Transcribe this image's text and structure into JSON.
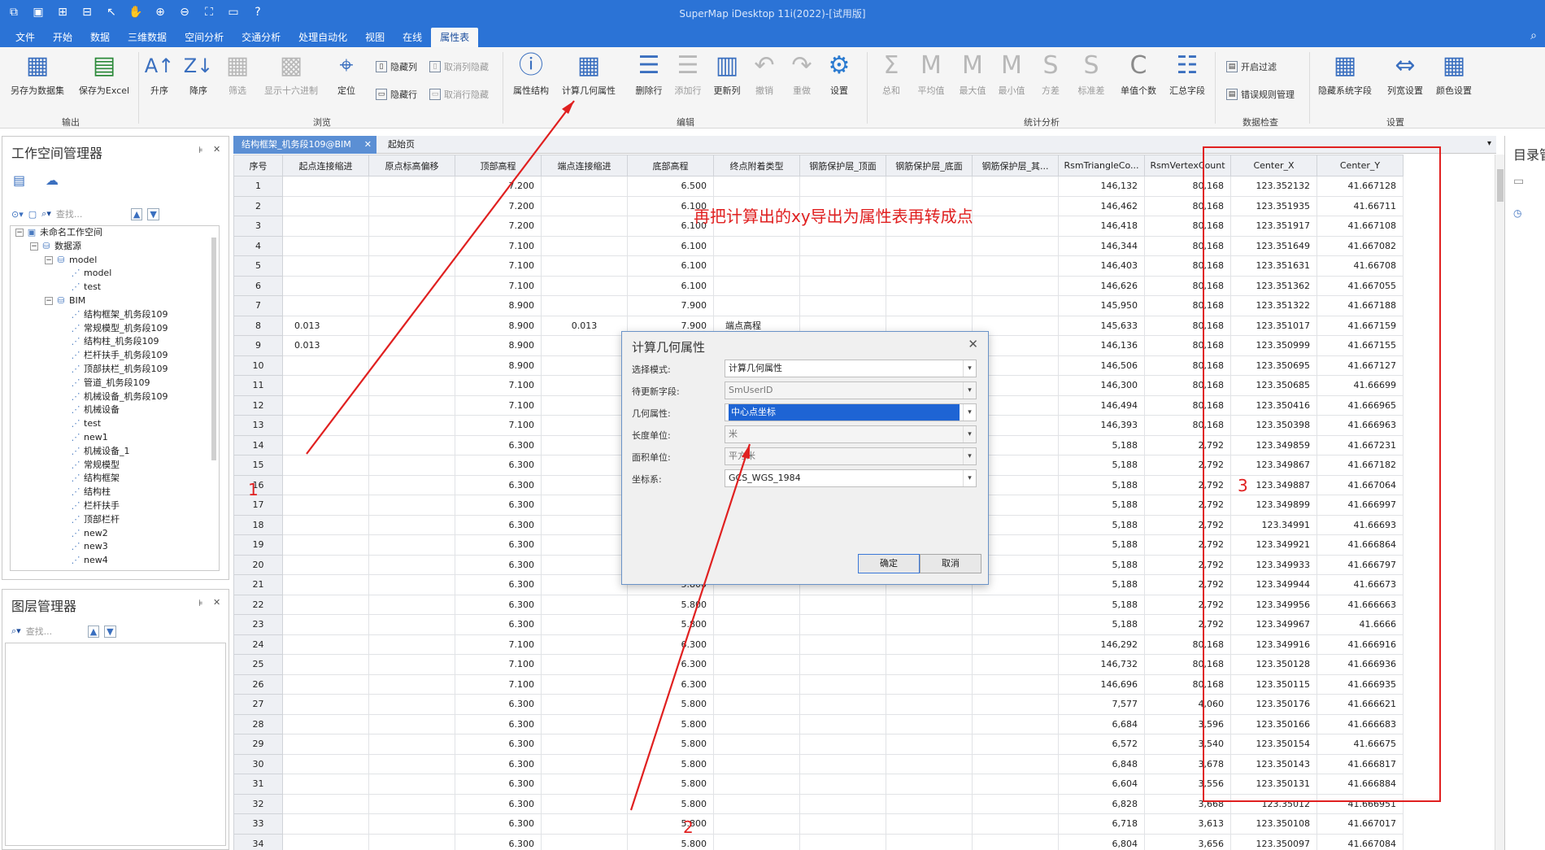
{
  "app": {
    "title": "SuperMap iDesktop 11i(2022)-[试用版]",
    "help_icon": "search-icon"
  },
  "menu": [
    "文件",
    "开始",
    "数据",
    "三维数据",
    "空间分析",
    "交通分析",
    "处理自动化",
    "视图",
    "在线",
    "属性表"
  ],
  "ribbon": {
    "output": {
      "save_dataset": "另存为数据集",
      "save_excel": "保存为Excel",
      "group": "输出"
    },
    "browse": {
      "asc": "升序",
      "desc": "降序",
      "filter": "筛选",
      "hex": "显示十六进制",
      "locate": "定位",
      "hide_col": "隐藏列",
      "unhide_col": "取消列隐藏",
      "hide_row": "隐藏行",
      "unhide_row": "取消行隐藏",
      "group": "浏览"
    },
    "edit": {
      "attr_struct": "属性结构",
      "calc_geo": "计算几何属性",
      "del_row": "删除行",
      "add_row": "添加行",
      "update_col": "更新列",
      "undo": "撤销",
      "redo": "重做",
      "settings": "设置",
      "group": "编辑"
    },
    "stats": {
      "sum": "总和",
      "avg": "平均值",
      "max": "最大值",
      "min": "最小值",
      "var": "方差",
      "std": "标准差",
      "unique": "单值个数",
      "summary": "汇总字段",
      "group": "统计分析"
    },
    "check": {
      "open_filter": "开启过滤",
      "err_rules": "错误规则管理",
      "group": "数据检查"
    },
    "setting": {
      "hide_sys": "隐藏系统字段",
      "col_width": "列宽设置",
      "color": "颜色设置",
      "group": "设置"
    }
  },
  "workspace": {
    "title": "工作空间管理器",
    "search_placeholder": "查找...",
    "tree": [
      {
        "label": "未命名工作空间",
        "level": 0,
        "toggle": "-",
        "icon": "workspace-icon"
      },
      {
        "label": "数据源",
        "level": 1,
        "toggle": "-",
        "icon": "datasources-icon"
      },
      {
        "label": "model",
        "level": 2,
        "toggle": "-",
        "icon": "database-icon"
      },
      {
        "label": "model",
        "level": 3,
        "toggle": "",
        "icon": "network-icon"
      },
      {
        "label": "test",
        "level": 3,
        "toggle": "",
        "icon": "network-icon"
      },
      {
        "label": "BIM",
        "level": 2,
        "toggle": "-",
        "icon": "database-icon"
      },
      {
        "label": "结构框架_机务段109",
        "level": 3,
        "toggle": "",
        "icon": "network-icon"
      },
      {
        "label": "常规模型_机务段109",
        "level": 3,
        "toggle": "",
        "icon": "network-icon"
      },
      {
        "label": "结构柱_机务段109",
        "level": 3,
        "toggle": "",
        "icon": "network-icon"
      },
      {
        "label": "栏杆扶手_机务段109",
        "level": 3,
        "toggle": "",
        "icon": "network-icon"
      },
      {
        "label": "顶部扶栏_机务段109",
        "level": 3,
        "toggle": "",
        "icon": "network-icon"
      },
      {
        "label": "管道_机务段109",
        "level": 3,
        "toggle": "",
        "icon": "network-icon"
      },
      {
        "label": "机械设备_机务段109",
        "level": 3,
        "toggle": "",
        "icon": "network-icon"
      },
      {
        "label": "机械设备",
        "level": 3,
        "toggle": "",
        "icon": "network-icon"
      },
      {
        "label": "test",
        "level": 3,
        "toggle": "",
        "icon": "network-icon"
      },
      {
        "label": "new1",
        "level": 3,
        "toggle": "",
        "icon": "network-icon"
      },
      {
        "label": "机械设备_1",
        "level": 3,
        "toggle": "",
        "icon": "network-icon"
      },
      {
        "label": "常规模型",
        "level": 3,
        "toggle": "",
        "icon": "network-icon"
      },
      {
        "label": "结构框架",
        "level": 3,
        "toggle": "",
        "icon": "network-icon"
      },
      {
        "label": "结构柱",
        "level": 3,
        "toggle": "",
        "icon": "network-icon"
      },
      {
        "label": "栏杆扶手",
        "level": 3,
        "toggle": "",
        "icon": "network-icon"
      },
      {
        "label": "顶部栏杆",
        "level": 3,
        "toggle": "",
        "icon": "network-icon"
      },
      {
        "label": "new2",
        "level": 3,
        "toggle": "",
        "icon": "network-icon"
      },
      {
        "label": "new3",
        "level": 3,
        "toggle": "",
        "icon": "network-icon"
      },
      {
        "label": "new4",
        "level": 3,
        "toggle": "",
        "icon": "network-icon"
      }
    ]
  },
  "layers": {
    "title": "图层管理器",
    "search_placeholder": "查找..."
  },
  "right_panel": {
    "title": "目录管"
  },
  "tabs": [
    {
      "label": "结构框架_机务段109@BIM",
      "active": true
    },
    {
      "label": "起始页",
      "active": false
    }
  ],
  "table": {
    "columns": [
      "序号",
      "起点连接缩进",
      "原点标高偏移",
      "顶部高程",
      "端点连接缩进",
      "底部高程",
      "终点附着类型",
      "钢筋保护层_顶面",
      "钢筋保护层_底面",
      "钢筋保护层_其...",
      "RsmTriangleCo...",
      "RsmVertexCount",
      "Center_X",
      "Center_Y"
    ],
    "rows": [
      [
        "1",
        "",
        "",
        "7.200",
        "",
        "6.500",
        "",
        "",
        "",
        "",
        "146,132",
        "80,168",
        "123.352132",
        "41.667128"
      ],
      [
        "2",
        "",
        "",
        "7.200",
        "",
        "6.100",
        "",
        "",
        "",
        "",
        "146,462",
        "80,168",
        "123.351935",
        "41.66711"
      ],
      [
        "3",
        "",
        "",
        "7.200",
        "",
        "6.100",
        "",
        "",
        "",
        "",
        "146,418",
        "80,168",
        "123.351917",
        "41.667108"
      ],
      [
        "4",
        "",
        "",
        "7.100",
        "",
        "6.100",
        "",
        "",
        "",
        "",
        "146,344",
        "80,168",
        "123.351649",
        "41.667082"
      ],
      [
        "5",
        "",
        "",
        "7.100",
        "",
        "6.100",
        "",
        "",
        "",
        "",
        "146,403",
        "80,168",
        "123.351631",
        "41.66708"
      ],
      [
        "6",
        "",
        "",
        "7.100",
        "",
        "6.100",
        "",
        "",
        "",
        "",
        "146,626",
        "80,168",
        "123.351362",
        "41.667055"
      ],
      [
        "7",
        "",
        "",
        "8.900",
        "",
        "7.900",
        "",
        "",
        "",
        "",
        "145,950",
        "80,168",
        "123.351322",
        "41.667188"
      ],
      [
        "8",
        "0.013",
        "",
        "8.900",
        "0.013",
        "7.900",
        "端点高程",
        "",
        "",
        "",
        "145,633",
        "80,168",
        "123.351017",
        "41.667159"
      ],
      [
        "9",
        "0.013",
        "",
        "8.900",
        "",
        "",
        "",
        "",
        "",
        "",
        "146,136",
        "80,168",
        "123.350999",
        "41.667155"
      ],
      [
        "10",
        "",
        "",
        "8.900",
        "",
        "",
        "",
        "",
        "",
        "",
        "146,506",
        "80,168",
        "123.350695",
        "41.667127"
      ],
      [
        "11",
        "",
        "",
        "7.100",
        "",
        "",
        "",
        "",
        "",
        "",
        "146,300",
        "80,168",
        "123.350685",
        "41.66699"
      ],
      [
        "12",
        "",
        "",
        "7.100",
        "",
        "",
        "",
        "",
        "",
        "",
        "146,494",
        "80,168",
        "123.350416",
        "41.666965"
      ],
      [
        "13",
        "",
        "",
        "7.100",
        "",
        "",
        "",
        "",
        "",
        "",
        "146,393",
        "80,168",
        "123.350398",
        "41.666963"
      ],
      [
        "14",
        "",
        "",
        "6.300",
        "",
        "",
        "",
        "",
        "",
        "",
        "5,188",
        "2,792",
        "123.349859",
        "41.667231"
      ],
      [
        "15",
        "",
        "",
        "6.300",
        "",
        "",
        "",
        "",
        "",
        "",
        "5,188",
        "2,792",
        "123.349867",
        "41.667182"
      ],
      [
        "16",
        "",
        "",
        "6.300",
        "",
        "",
        "",
        "",
        "",
        "",
        "5,188",
        "2,792",
        "123.349887",
        "41.667064"
      ],
      [
        "17",
        "",
        "",
        "6.300",
        "",
        "",
        "",
        "",
        "",
        "",
        "5,188",
        "2,792",
        "123.349899",
        "41.666997"
      ],
      [
        "18",
        "",
        "",
        "6.300",
        "",
        "",
        "",
        "",
        "",
        "",
        "5,188",
        "2,792",
        "123.34991",
        "41.66693"
      ],
      [
        "19",
        "",
        "",
        "6.300",
        "",
        "",
        "",
        "",
        "",
        "",
        "5,188",
        "2,792",
        "123.349921",
        "41.666864"
      ],
      [
        "20",
        "",
        "",
        "6.300",
        "",
        "",
        "",
        "",
        "",
        "",
        "5,188",
        "2,792",
        "123.349933",
        "41.666797"
      ],
      [
        "21",
        "",
        "",
        "6.300",
        "",
        "5.800",
        "",
        "",
        "",
        "",
        "5,188",
        "2,792",
        "123.349944",
        "41.66673"
      ],
      [
        "22",
        "",
        "",
        "6.300",
        "",
        "5.800",
        "",
        "",
        "",
        "",
        "5,188",
        "2,792",
        "123.349956",
        "41.666663"
      ],
      [
        "23",
        "",
        "",
        "6.300",
        "",
        "5.800",
        "",
        "",
        "",
        "",
        "5,188",
        "2,792",
        "123.349967",
        "41.6666"
      ],
      [
        "24",
        "",
        "",
        "7.100",
        "",
        "6.300",
        "",
        "",
        "",
        "",
        "146,292",
        "80,168",
        "123.349916",
        "41.666916"
      ],
      [
        "25",
        "",
        "",
        "7.100",
        "",
        "6.300",
        "",
        "",
        "",
        "",
        "146,732",
        "80,168",
        "123.350128",
        "41.666936"
      ],
      [
        "26",
        "",
        "",
        "7.100",
        "",
        "6.300",
        "",
        "",
        "",
        "",
        "146,696",
        "80,168",
        "123.350115",
        "41.666935"
      ],
      [
        "27",
        "",
        "",
        "6.300",
        "",
        "5.800",
        "",
        "",
        "",
        "",
        "7,577",
        "4,060",
        "123.350176",
        "41.666621"
      ],
      [
        "28",
        "",
        "",
        "6.300",
        "",
        "5.800",
        "",
        "",
        "",
        "",
        "6,684",
        "3,596",
        "123.350166",
        "41.666683"
      ],
      [
        "29",
        "",
        "",
        "6.300",
        "",
        "5.800",
        "",
        "",
        "",
        "",
        "6,572",
        "3,540",
        "123.350154",
        "41.66675"
      ],
      [
        "30",
        "",
        "",
        "6.300",
        "",
        "5.800",
        "",
        "",
        "",
        "",
        "6,848",
        "3,678",
        "123.350143",
        "41.666817"
      ],
      [
        "31",
        "",
        "",
        "6.300",
        "",
        "5.800",
        "",
        "",
        "",
        "",
        "6,604",
        "3,556",
        "123.350131",
        "41.666884"
      ],
      [
        "32",
        "",
        "",
        "6.300",
        "",
        "5.800",
        "",
        "",
        "",
        "",
        "6,828",
        "3,668",
        "123.35012",
        "41.666951"
      ],
      [
        "33",
        "",
        "",
        "6.300",
        "",
        "5.800",
        "",
        "",
        "",
        "",
        "6,718",
        "3,613",
        "123.350108",
        "41.667017"
      ],
      [
        "34",
        "",
        "",
        "6.300",
        "",
        "5.800",
        "",
        "",
        "",
        "",
        "6,804",
        "3,656",
        "123.350097",
        "41.667084"
      ]
    ]
  },
  "dialog": {
    "title": "计算几何属性",
    "fields": [
      {
        "label": "选择模式:",
        "value": "计算几何属性",
        "disabled": false,
        "selected": false
      },
      {
        "label": "待更新字段:",
        "value": "SmUserID",
        "disabled": true,
        "selected": false
      },
      {
        "label": "几何属性:",
        "value": "中心点坐标",
        "disabled": false,
        "selected": true
      },
      {
        "label": "长度单位:",
        "value": "米",
        "disabled": true,
        "selected": false
      },
      {
        "label": "面积单位:",
        "value": "平方米",
        "disabled": true,
        "selected": false
      },
      {
        "label": "坐标系:",
        "value": "GCS_WGS_1984",
        "disabled": false,
        "selected": false
      }
    ],
    "ok": "确定",
    "cancel": "取消"
  },
  "annotations": {
    "text": "再把计算出的xy导出为属性表再转成点",
    "n1": "1",
    "n2": "2",
    "n3": "3",
    "color": "#e02020"
  }
}
